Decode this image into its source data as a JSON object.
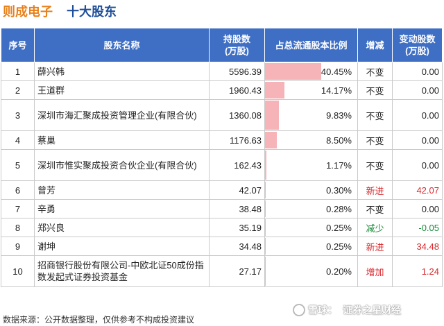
{
  "title": {
    "company": "则成电子",
    "subtitle": "十大股东"
  },
  "table": {
    "headers": {
      "rank": "序号",
      "name": "股东名称",
      "shares_l1": "持股数",
      "shares_l2": "(万股)",
      "ratio": "占总流通股本比例",
      "change": "增减",
      "delta_l1": "变动股数",
      "delta_l2": "(万股)"
    },
    "rows": [
      {
        "rank": "1",
        "name": "薛兴韩",
        "shares": "5596.39",
        "ratio": "40.45%",
        "ratio_value": 40.45,
        "change": "不变",
        "delta": "0.00"
      },
      {
        "rank": "2",
        "name": "王道群",
        "shares": "1960.43",
        "ratio": "14.17%",
        "ratio_value": 14.17,
        "change": "不变",
        "delta": "0.00"
      },
      {
        "rank": "3",
        "name": "深圳市海汇聚成投资管理企业(有限合伙)",
        "shares": "1360.08",
        "ratio": "9.83%",
        "ratio_value": 9.83,
        "change": "不变",
        "delta": "0.00"
      },
      {
        "rank": "4",
        "name": "蔡巢",
        "shares": "1176.63",
        "ratio": "8.50%",
        "ratio_value": 8.5,
        "change": "不变",
        "delta": "0.00"
      },
      {
        "rank": "5",
        "name": "深圳市惟实聚成投资合伙企业(有限合伙)",
        "shares": "162.43",
        "ratio": "1.17%",
        "ratio_value": 1.17,
        "change": "不变",
        "delta": "0.00"
      },
      {
        "rank": "6",
        "name": "曾芳",
        "shares": "42.07",
        "ratio": "0.30%",
        "ratio_value": 0.3,
        "change": "新进",
        "delta": "42.07"
      },
      {
        "rank": "7",
        "name": "辛勇",
        "shares": "38.48",
        "ratio": "0.28%",
        "ratio_value": 0.28,
        "change": "不变",
        "delta": "0.00"
      },
      {
        "rank": "8",
        "name": "郑兴良",
        "shares": "35.19",
        "ratio": "0.25%",
        "ratio_value": 0.25,
        "change": "减少",
        "delta": "-0.05"
      },
      {
        "rank": "9",
        "name": "谢坤",
        "shares": "34.48",
        "ratio": "0.25%",
        "ratio_value": 0.25,
        "change": "新进",
        "delta": "34.48"
      },
      {
        "rank": "10",
        "name": "招商银行股份有限公司-中欧北证50成份指数发起式证券投资基金",
        "shares": "27.17",
        "ratio": "0.20%",
        "ratio_value": 0.2,
        "change": "增加",
        "delta": "1.24"
      }
    ]
  },
  "footer": {
    "source": "数据来源：公开数据整理，仅供参考不构成投资建议"
  },
  "watermark": {
    "brand": "雪球",
    "sep": "：",
    "account": "证券之星财经"
  },
  "colors": {
    "header_bg": "#3e6fc4",
    "bar": "#f6b3b8",
    "increase": "#d8282d",
    "decrease": "#1a8a3a",
    "company_title": "#e8801a",
    "subtitle": "#1f4e9a"
  }
}
